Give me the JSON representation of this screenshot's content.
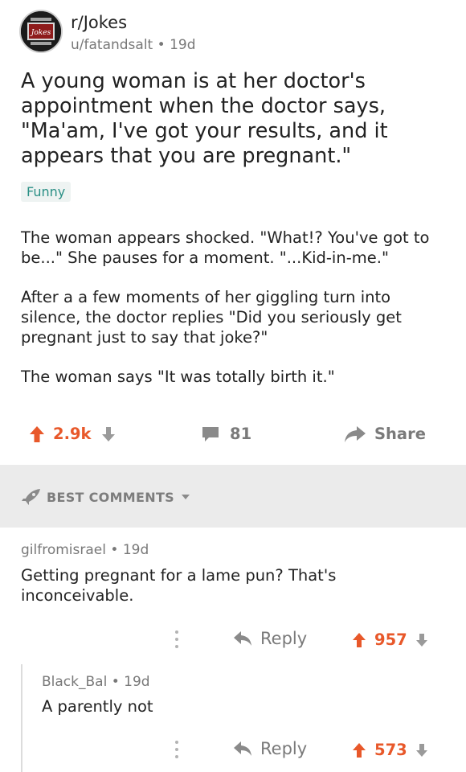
{
  "post": {
    "subreddit": "r/Jokes",
    "author": "u/fatandsalt",
    "age": "19d",
    "avatar_text": "Jokes",
    "title": "A young woman is at her doctor's appointment when the doctor says, \"Ma'am, I've got your results, and it appears that you are pregnant.\"",
    "flair": "Funny",
    "body": [
      "The woman appears shocked. \"What!? You've got to be...\" She pauses for a moment. \"...Kid-in-me.\"",
      "After a a few moments of her giggling turn into silence, the doctor replies \"Did you seriously get pregnant just to say that joke?\"",
      "The woman says \"It was totally birth it.\""
    ],
    "score": "2.9k",
    "comments_count": "81",
    "share_label": "Share"
  },
  "comments_header": "BEST COMMENTS",
  "comments": [
    {
      "author": "gilfromisrael",
      "age": "19d",
      "text": "Getting pregnant for a lame pun? That's inconceivable.",
      "reply_label": "Reply",
      "score": "957"
    },
    {
      "author": "Black_Bal",
      "age": "19d",
      "text": "A parently not",
      "reply_label": "Reply",
      "score": "573"
    }
  ],
  "colors": {
    "upvote": "#e8582a",
    "flair_text": "#2a8f85",
    "muted": "#787878"
  },
  "icons": [
    "upvote-icon",
    "downvote-icon",
    "comment-icon",
    "share-icon",
    "rocket-icon",
    "chevron-down-icon",
    "more-icon",
    "reply-icon"
  ]
}
